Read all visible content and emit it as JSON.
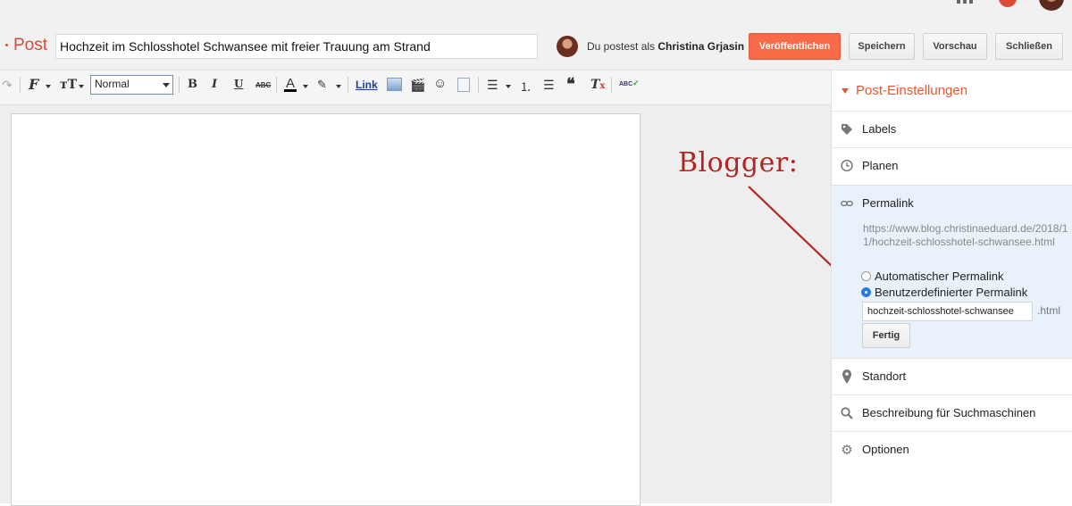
{
  "header": {
    "post_label": "Post",
    "title_value": "Hochzeit im Schlosshotel Schwansee mit freier Trauung am Strand",
    "posting_as_prefix": "Du postest als",
    "posting_as_name": "Christina Grjasin",
    "publish": "Veröffentlichen",
    "save": "Speichern",
    "preview": "Vorschau",
    "close": "Schließen"
  },
  "toolbar": {
    "format_select": "Normal",
    "bold": "B",
    "italic": "I",
    "underline": "U",
    "strike": "ABC",
    "text_color": "A",
    "link": "Link",
    "spellcheck": "ABC"
  },
  "annotation": {
    "text": "Blogger:"
  },
  "sidebar": {
    "heading": "Post-Einstellungen",
    "labels": "Labels",
    "schedule": "Planen",
    "permalink": "Permalink",
    "permalink_url": "https://www.blog.christinaeduard.de/2018/11/hochzeit-schlosshotel-schwansee.html",
    "auto_permalink": "Automatischer Permalink",
    "custom_permalink": "Benutzerdefinierter Permalink",
    "slug_value": "hochzeit-schlosshotel-schwansee",
    "extension": ".html",
    "done": "Fertig",
    "location": "Standort",
    "search_description": "Beschreibung für Suchmaschinen",
    "options": "Optionen"
  },
  "colors": {
    "accent": "#dd4b39",
    "publish_bg": "#f96b47",
    "annotation": "#b3241f",
    "permalink_bg": "#e9f1fb"
  }
}
